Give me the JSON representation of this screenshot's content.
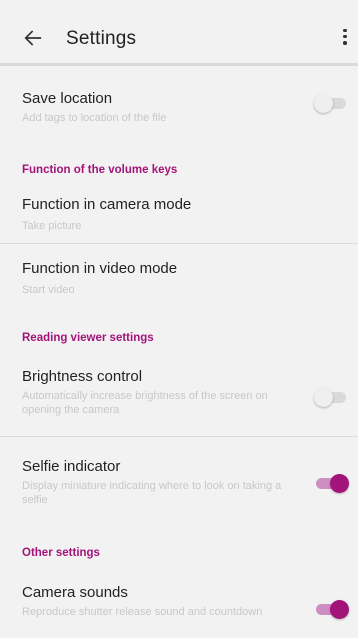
{
  "header": {
    "title": "Settings",
    "back_icon": "arrow-left-icon",
    "menu_icon": "more-vert-icon"
  },
  "accent_color": "#a3147a",
  "settings": {
    "save_location": {
      "title": "Save location",
      "subtitle": "Add tags to location of the file",
      "enabled": false
    },
    "volume_section": "Function of the volume keys",
    "camera_mode": {
      "title": "Function in camera mode",
      "value": "Take picture"
    },
    "video_mode": {
      "title": "Function in video mode",
      "value": "Start video"
    },
    "reading_section": "Reading viewer settings",
    "brightness": {
      "title": "Brightness control",
      "subtitle": "Automatically increase brightness of the screen on opening the camera",
      "enabled": false
    },
    "selfie": {
      "title": "Selfie indicator",
      "subtitle": "Display miniature indicating where to look on taking a selfie",
      "enabled": true
    },
    "other_section": "Other settings",
    "sounds": {
      "title": "Camera sounds",
      "subtitle": "Reproduce shutter release sound and countdown",
      "enabled": true
    }
  }
}
